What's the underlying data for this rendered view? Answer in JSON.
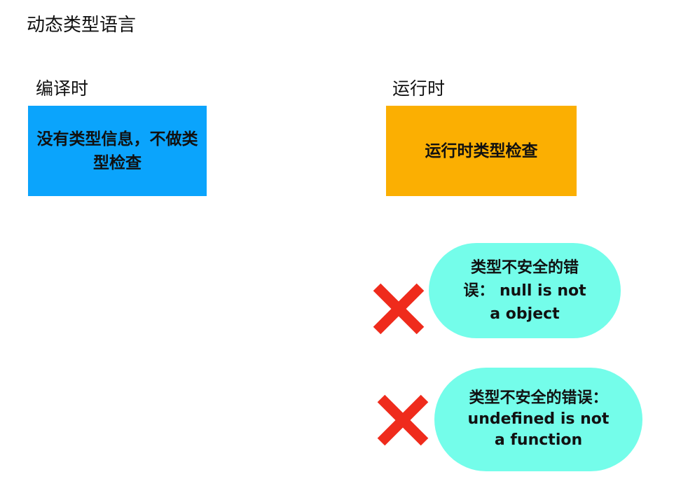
{
  "title": "动态类型语言",
  "compile_time": {
    "heading": "编译时",
    "box_text": "没有类型信息，不做类型检查",
    "box_color": "#0ba4fc"
  },
  "runtime": {
    "heading": "运行时",
    "box_text": "运行时类型检查",
    "box_color": "#fbaf02"
  },
  "errors": [
    {
      "text": "类型不安全的错误： null is not a object",
      "icon": "cross-icon"
    },
    {
      "text": "类型不安全的错误： undefined is not a function",
      "icon": "cross-icon"
    }
  ],
  "colors": {
    "bubble": "#74fdea",
    "cross": "#ef2b1c"
  }
}
